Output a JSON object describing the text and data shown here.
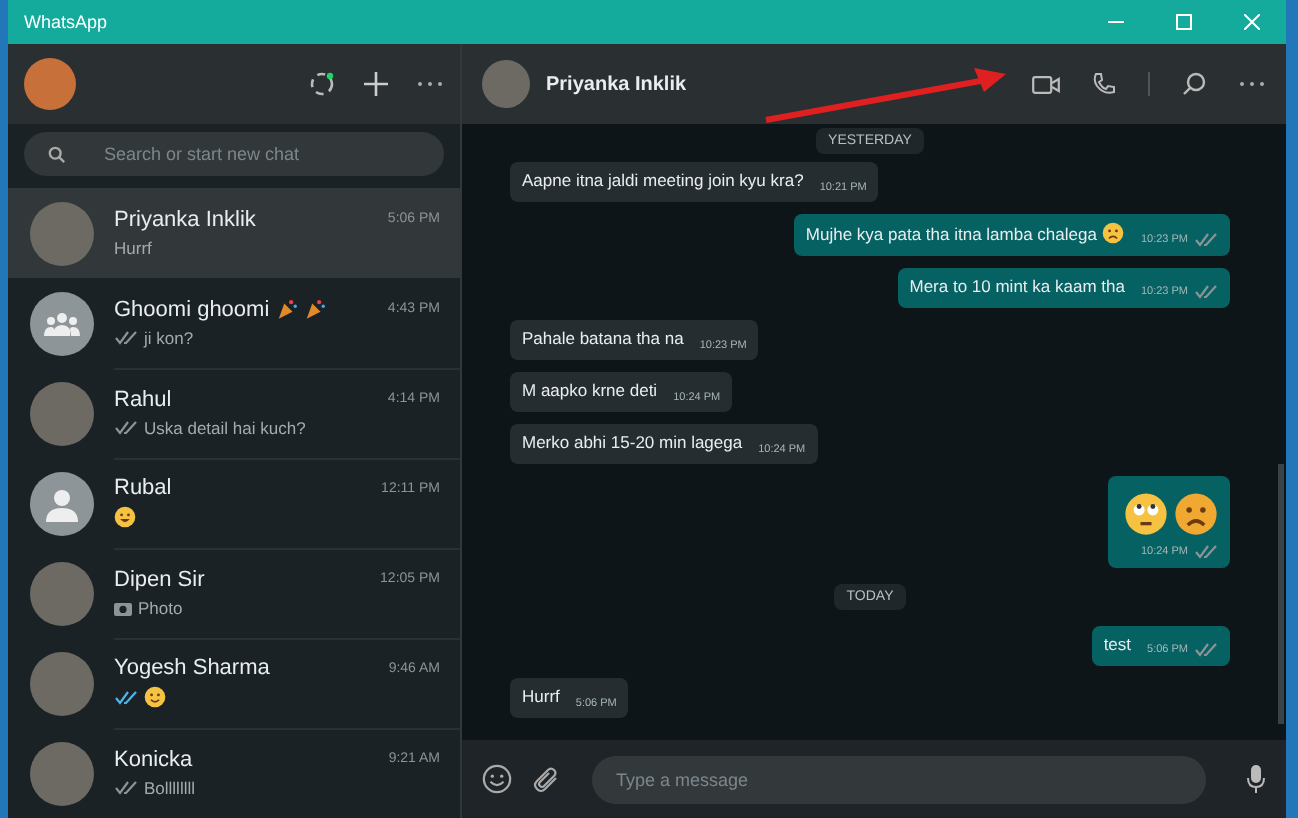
{
  "window": {
    "title": "WhatsApp"
  },
  "sidebar": {
    "search": {
      "placeholder": "Search or start new chat"
    },
    "chats": [
      {
        "name": "Priyanka Inklik",
        "time": "5:06 PM",
        "preview": "Hurrf",
        "kind": "photo",
        "selected": true
      },
      {
        "name": "Ghoomi ghoomi",
        "time": "4:43 PM",
        "preview": "ji kon?",
        "kind": "group",
        "delivered": true,
        "name_emojis": [
          {
            "kind": "party"
          },
          {
            "kind": "party"
          }
        ],
        "selected": false
      },
      {
        "name": "Rahul",
        "time": "4:14 PM",
        "preview": "Uska detail hai kuch?",
        "kind": "photo",
        "delivered": true,
        "selected": false
      },
      {
        "name": "Rubal",
        "time": "12:11 PM",
        "kind": "default",
        "preview_emojis": [
          {
            "kind": "grin"
          }
        ],
        "selected": false
      },
      {
        "name": "Dipen Sir",
        "time": "12:05 PM",
        "preview": "Photo",
        "kind": "photo",
        "photo_attachment": true,
        "selected": false
      },
      {
        "name": "Yogesh Sharma",
        "time": "9:46 AM",
        "kind": "photo",
        "delivered": true,
        "read": true,
        "preview_emojis": [
          {
            "kind": "smile"
          }
        ],
        "selected": false
      },
      {
        "name": "Konicka",
        "time": "9:21 AM",
        "preview": "Bollllllll",
        "kind": "photo",
        "delivered": true,
        "selected": false
      }
    ]
  },
  "chat": {
    "contact": "Priyanka Inklik",
    "messages": [
      {
        "kind": "date",
        "text": "YESTERDAY"
      },
      {
        "kind": "in",
        "text": "Aapne itna jaldi meeting join kyu kra?",
        "time": "10:21 PM"
      },
      {
        "kind": "out",
        "text": "Mujhe kya pata tha itna lamba chalega",
        "time": "10:23 PM",
        "emojis": [
          {
            "kind": "sad"
          }
        ],
        "delivered": true
      },
      {
        "kind": "out",
        "text": "Mera to 10 mint ka kaam tha",
        "time": "10:23 PM",
        "delivered": true
      },
      {
        "kind": "in",
        "text": "Pahale batana tha na",
        "time": "10:23 PM"
      },
      {
        "kind": "in",
        "text": "M aapko krne deti",
        "time": "10:24 PM"
      },
      {
        "kind": "in",
        "text": "Merko abhi 15-20 min lagega",
        "time": "10:24 PM"
      },
      {
        "kind": "out",
        "time": "10:24 PM",
        "emojis": [
          {
            "kind": "eyeroll"
          },
          {
            "kind": "tired"
          }
        ],
        "delivered": true
      },
      {
        "kind": "date",
        "text": "TODAY"
      },
      {
        "kind": "out",
        "text": "test",
        "time": "5:06 PM",
        "delivered": true
      },
      {
        "kind": "in",
        "text": "Hurrf",
        "time": "5:06 PM"
      }
    ],
    "composer": {
      "placeholder": "Type a message"
    }
  }
}
